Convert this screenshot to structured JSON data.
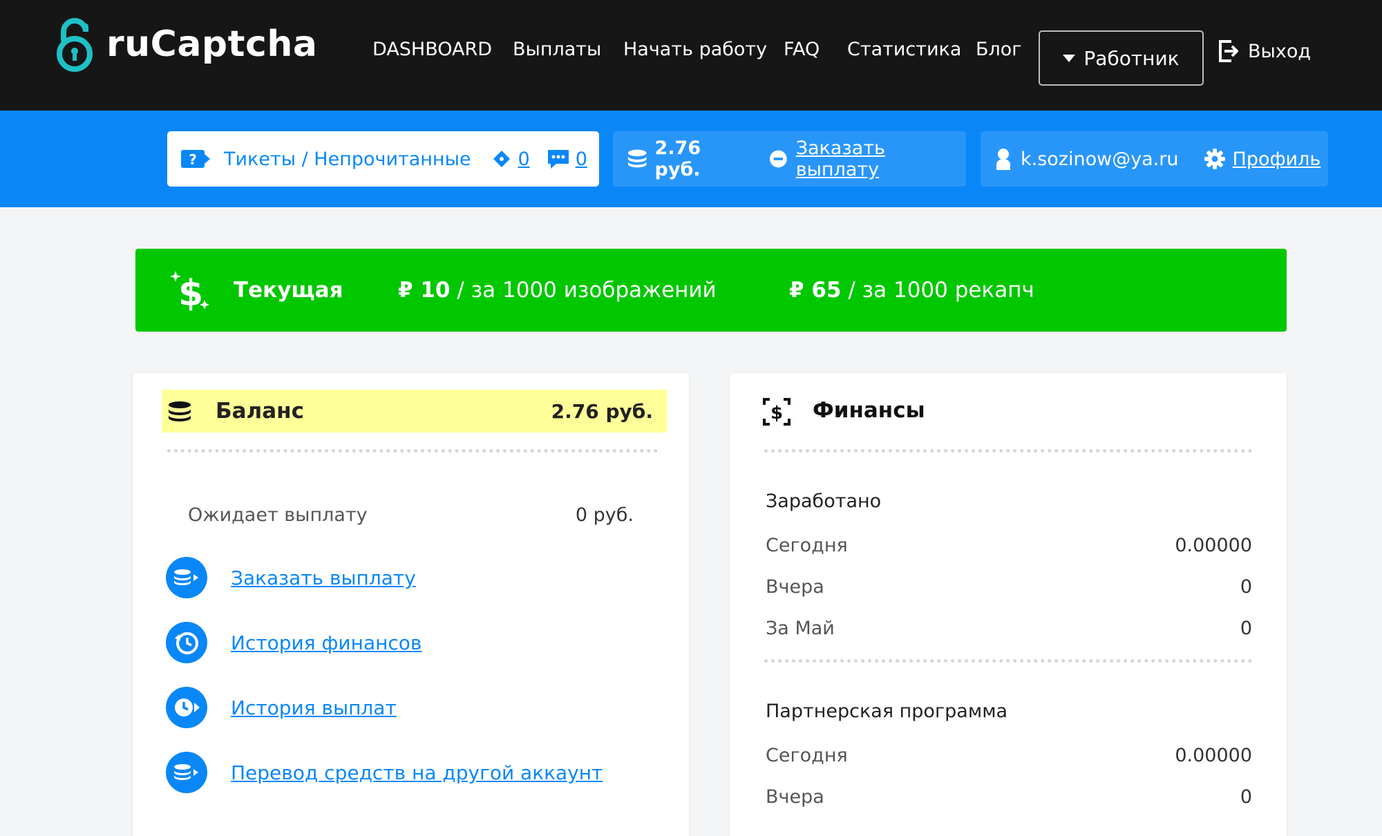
{
  "header": {
    "logo_text": "ruCaptcha",
    "nav": [
      "DASHBOARD",
      "Выплаты",
      "Начать работу",
      "FAQ",
      "Статистика",
      "Блог"
    ],
    "role_button": "Работник",
    "exit_label": "Выход"
  },
  "toolbar": {
    "tickets_label": "Тикеты / Непрочитанные",
    "tickets_count": "0",
    "messages_count": "0",
    "balance": "2.76 руб.",
    "order_payout": "Заказать выплату",
    "email": "k.sozinow@ya.ru",
    "profile": "Профиль"
  },
  "rates": {
    "label": "Текущая",
    "images_price": "₽ 10",
    "images_unit": " / за 1000 изображений",
    "recaptcha_price": "₽ 65",
    "recaptcha_unit": " / за 1000 рекапч"
  },
  "balance_card": {
    "title": "Баланс",
    "value": "2.76 руб.",
    "pending_label": "Ожидает выплату",
    "pending_value": "0 руб.",
    "links": [
      "Заказать выплату",
      "История финансов",
      "История выплат",
      "Перевод средств на другой аккаунт"
    ]
  },
  "finance_card": {
    "title": "Финансы",
    "earned": {
      "title": "Заработано",
      "rows": [
        {
          "label": "Сегодня",
          "value": "0.00000"
        },
        {
          "label": "Вчера",
          "value": "0"
        },
        {
          "label": "За Май",
          "value": "0"
        }
      ]
    },
    "partner": {
      "title": "Партнерская программа",
      "rows": [
        {
          "label": "Сегодня",
          "value": "0.00000"
        },
        {
          "label": "Вчера",
          "value": "0"
        }
      ]
    }
  },
  "colors": {
    "header": "#161616",
    "accent": "#0a87f7",
    "banner": "#00c700",
    "balance_highlight": "#ffff99"
  }
}
